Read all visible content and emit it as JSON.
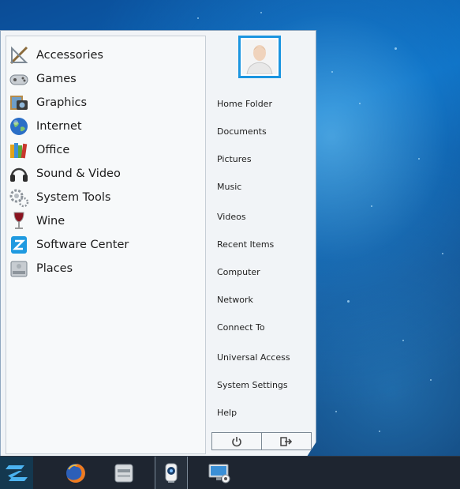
{
  "menu": {
    "categories": [
      {
        "label": "Accessories",
        "icon": "accessories-icon"
      },
      {
        "label": "Games",
        "icon": "gamepad-icon"
      },
      {
        "label": "Graphics",
        "icon": "graphics-icon"
      },
      {
        "label": "Internet",
        "icon": "globe-icon"
      },
      {
        "label": "Office",
        "icon": "office-books-icon"
      },
      {
        "label": "Sound & Video",
        "icon": "headphones-icon"
      },
      {
        "label": "System Tools",
        "icon": "gears-icon"
      },
      {
        "label": "Wine",
        "icon": "wine-glass-icon"
      },
      {
        "label": "Software Center",
        "icon": "software-center-icon"
      },
      {
        "label": "Places",
        "icon": "drive-icon"
      }
    ],
    "places": [
      "Home Folder",
      "Documents",
      "Pictures",
      "Music",
      "Videos",
      "Recent Items",
      "Computer",
      "Network",
      "Connect To",
      "Universal Access",
      "System Settings",
      "Help"
    ],
    "power_icons": [
      "power-icon",
      "logout-icon"
    ]
  },
  "taskbar": {
    "items": [
      "zorin-logo-icon",
      "firefox-icon",
      "file-manager-icon",
      "webcam-icon",
      "remote-desktop-icon"
    ]
  },
  "colors": {
    "accent": "#1b95e0",
    "taskbar": "#1e2530",
    "menu_bg": "#f1f4f7"
  }
}
